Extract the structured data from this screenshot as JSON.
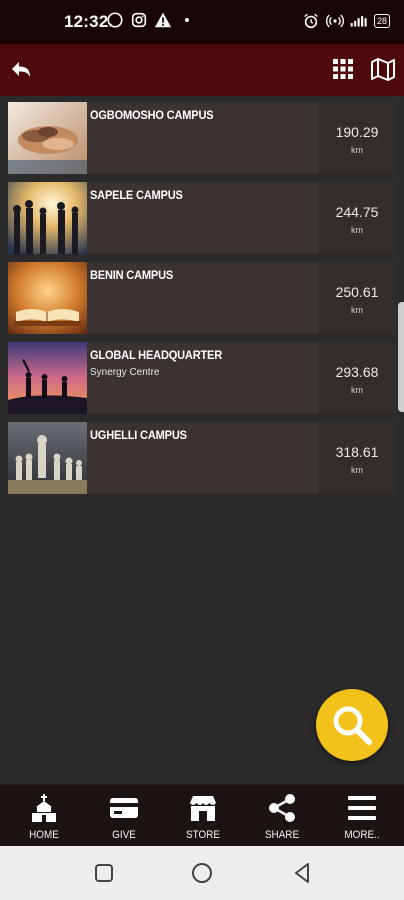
{
  "status_bar": {
    "time": "12:32",
    "left_icons": [
      "whatsapp-icon",
      "instagram-icon",
      "warning-icon",
      "dot-icon"
    ],
    "right_icons": [
      "alarm-icon",
      "hotspot-icon",
      "signal-icon"
    ],
    "battery": "28"
  },
  "app_bar": {
    "icons": [
      "back-arrow-icon",
      "grid-icon",
      "map-icon"
    ]
  },
  "campuses": [
    {
      "title": "OGBOMOSHO CAMPUS",
      "subtitle": "",
      "distance": "190.29",
      "unit": "km"
    },
    {
      "title": "SAPELE CAMPUS",
      "subtitle": "",
      "distance": "244.75",
      "unit": "km"
    },
    {
      "title": "BENIN CAMPUS",
      "subtitle": "",
      "distance": "250.61",
      "unit": "km"
    },
    {
      "title": "GLOBAL HEADQUARTER",
      "subtitle": "Synergy Centre",
      "distance": "293.68",
      "unit": "km"
    },
    {
      "title": "UGHELLI CAMPUS",
      "subtitle": "",
      "distance": "318.61",
      "unit": "km"
    }
  ],
  "fab": {
    "icon": "search-icon",
    "color": "#f2c21b"
  },
  "bottom_nav": [
    {
      "label": "HOME",
      "icon": "church-icon"
    },
    {
      "label": "GIVE",
      "icon": "card-icon"
    },
    {
      "label": "STORE",
      "icon": "store-icon"
    },
    {
      "label": "SHARE",
      "icon": "share-icon"
    },
    {
      "label": "MORE..",
      "icon": "menu-icon"
    }
  ],
  "system_nav": [
    "recents-icon",
    "home-icon",
    "back-icon"
  ],
  "colors": {
    "app_bar": "#4d0a0c",
    "status_bar": "#1a0506",
    "background": "#2b2b2b",
    "row": "#3a3330",
    "accent": "#f2c21b"
  }
}
